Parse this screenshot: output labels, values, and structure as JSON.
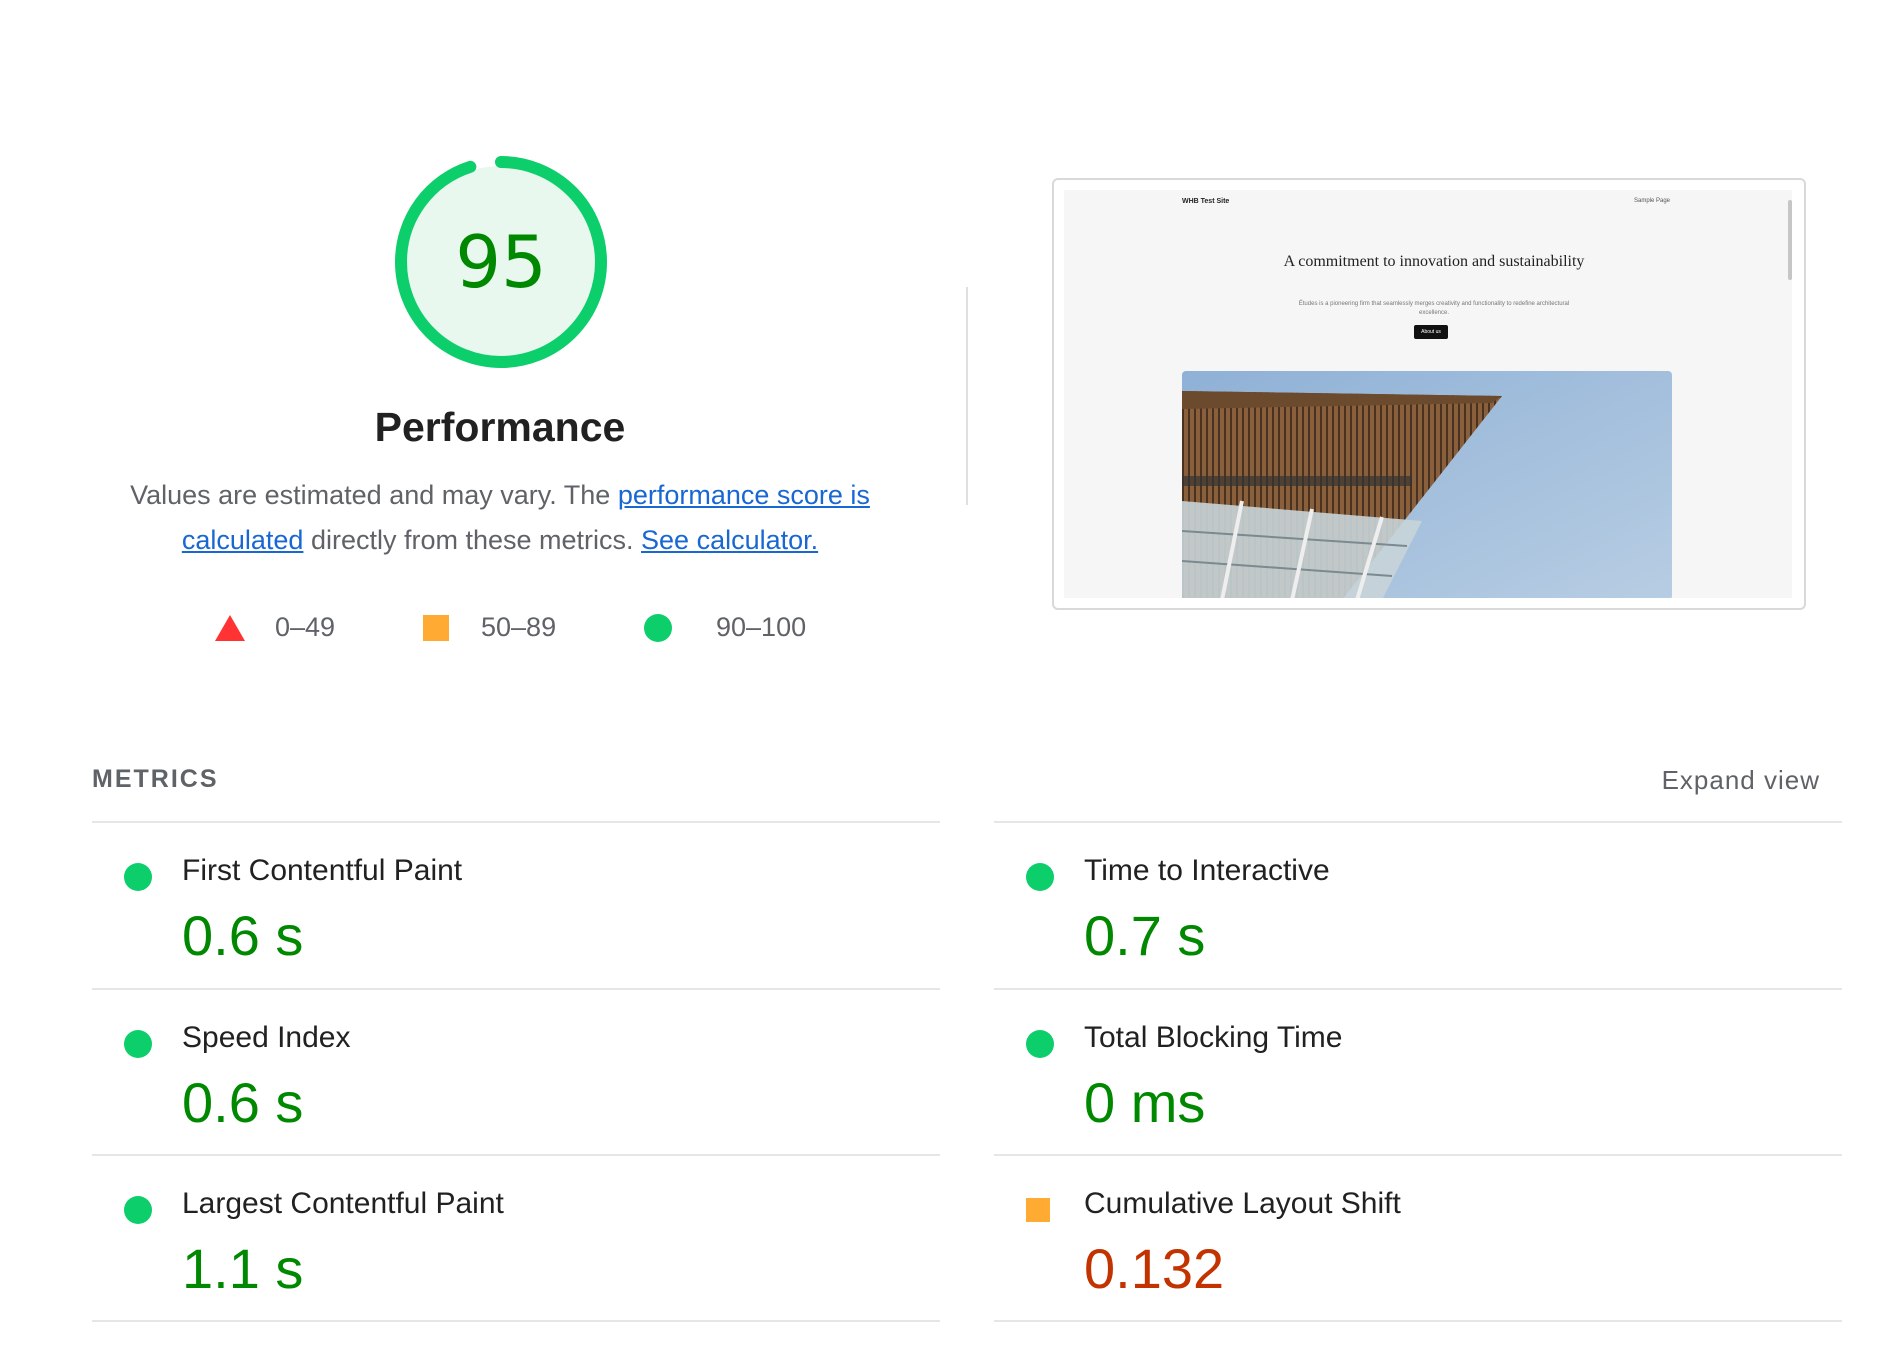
{
  "performance": {
    "score": "95",
    "score_fraction": 0.95,
    "title": "Performance",
    "desc_prefix": "Values are estimated and may vary. The ",
    "desc_link1": "performance score is calculated",
    "desc_middle": " directly from these metrics. ",
    "desc_link2": "See calculator.",
    "colors": {
      "pass": "#0cce6b",
      "pass_text": "#008800",
      "average": "#ffaa33",
      "fail": "#ff3333",
      "fail_text": "#c33300",
      "link": "#1967d2"
    }
  },
  "legend": {
    "fail": "0–49",
    "average": "50–89",
    "pass": "90–100"
  },
  "screenshot": {
    "site_name": "WHB Test Site",
    "nav_link": "Sample Page",
    "heading": "A commitment to innovation and sustainability",
    "subtext": "Études is a pioneering firm that seamlessly merges creativity and functionality to redefine architectural excellence.",
    "button": "About us"
  },
  "metrics": {
    "section_label": "METRICS",
    "expand_label": "Expand view",
    "left": [
      {
        "name": "First Contentful Paint",
        "value": "0.6 s",
        "status": "pass"
      },
      {
        "name": "Speed Index",
        "value": "0.6 s",
        "status": "pass"
      },
      {
        "name": "Largest Contentful Paint",
        "value": "1.1 s",
        "status": "pass"
      }
    ],
    "right": [
      {
        "name": "Time to Interactive",
        "value": "0.7 s",
        "status": "pass"
      },
      {
        "name": "Total Blocking Time",
        "value": "0 ms",
        "status": "pass"
      },
      {
        "name": "Cumulative Layout Shift",
        "value": "0.132",
        "status": "average"
      }
    ]
  }
}
